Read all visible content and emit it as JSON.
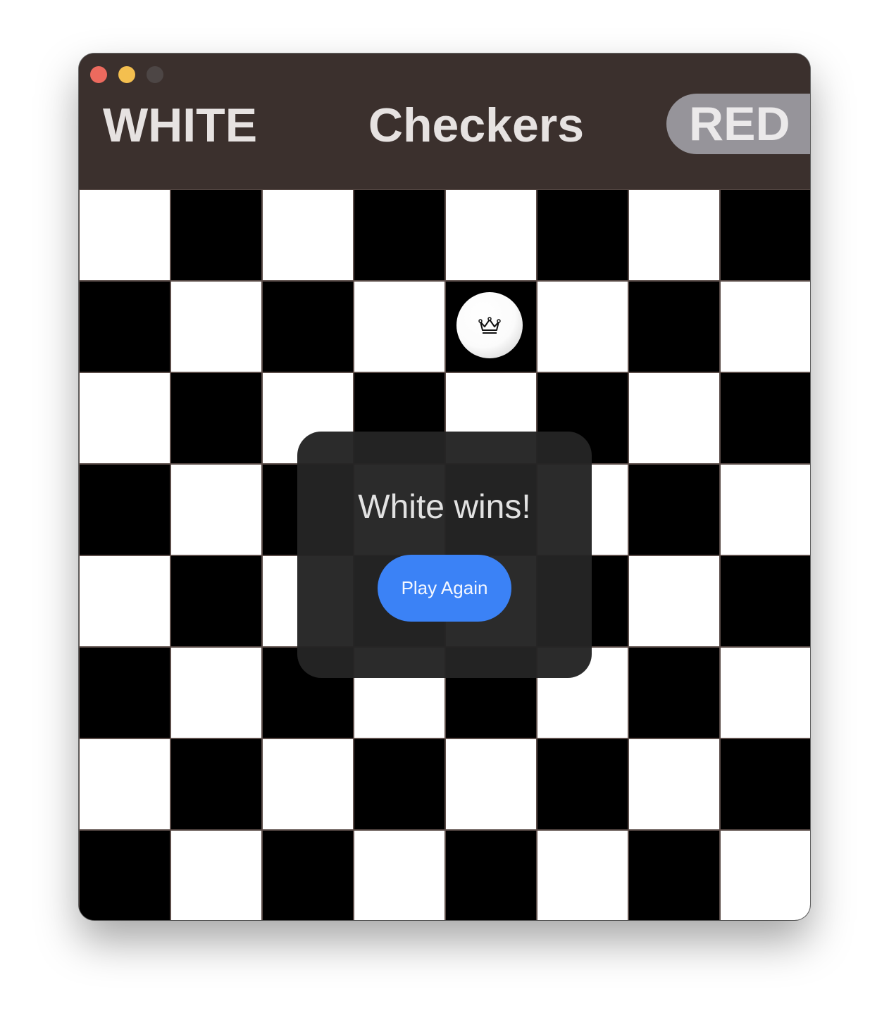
{
  "window": {
    "traffic_lights": [
      "close",
      "minimize",
      "maximize"
    ]
  },
  "header": {
    "left_player": "WHITE",
    "title": "Checkers",
    "right_player": "RED",
    "active_player": "RED"
  },
  "board": {
    "rows": 8,
    "cols": 8,
    "light_color": "#ffffff",
    "dark_color": "#000000",
    "pieces": [
      {
        "color": "white",
        "king": true,
        "row": 1,
        "col": 4,
        "icon": "crown-icon"
      }
    ]
  },
  "dialog": {
    "message": "White wins!",
    "button_label": "Play Again",
    "button_color": "#3b82f6"
  }
}
